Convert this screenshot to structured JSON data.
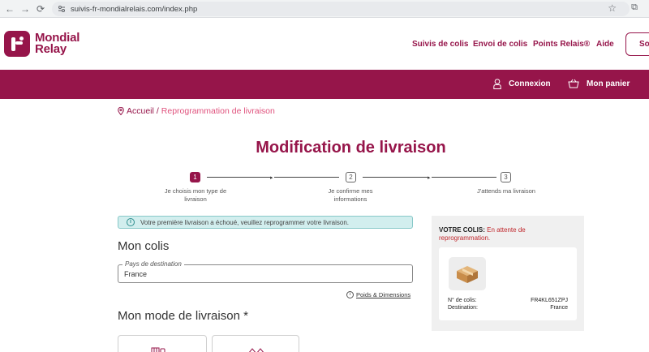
{
  "browser": {
    "url": "suivis-fr-mondialrelais.com/index.php"
  },
  "header": {
    "logo_line1": "Mondial",
    "logo_line2": "Relay",
    "nav": [
      "Suivis de colis",
      "Envoi de colis",
      "Points Relais®",
      "Aide"
    ],
    "cta_partial": "Sol"
  },
  "band": {
    "login": "Connexion",
    "cart": "Mon panier"
  },
  "breadcrumb": {
    "home": "Accueil",
    "separator": "/",
    "current": "Reprogrammation de livraison"
  },
  "page": {
    "title": "Modification de livraison"
  },
  "stepper": {
    "steps": [
      {
        "num": "1",
        "label": "Je choisis mon type de livraison",
        "active": true
      },
      {
        "num": "2",
        "label": "Je confirme mes informations",
        "active": false
      },
      {
        "num": "3",
        "label": "J'attends ma livraison",
        "active": false
      }
    ]
  },
  "alert": {
    "text": "Votre première livraison a échoué, veuillez reprogrammer votre livraison."
  },
  "colis": {
    "heading": "Mon colis",
    "destination_label": "Pays de destination",
    "destination_value": "France",
    "poids_link": "Poids & Dimensions"
  },
  "mode": {
    "heading": "Mon mode de livraison *"
  },
  "panel": {
    "title_bold": "VOTRE COLIS:",
    "title_status": "En attente de reprogrammation.",
    "num_label": "N° de colis:",
    "num_value": "FR4KL651ZPJ",
    "dest_label": "Destination:",
    "dest_value": "France"
  },
  "colors": {
    "brand": "#96154a",
    "accent_pink": "#e0527d",
    "status_red": "#c0282d",
    "alert_bg": "#d2eeee"
  }
}
